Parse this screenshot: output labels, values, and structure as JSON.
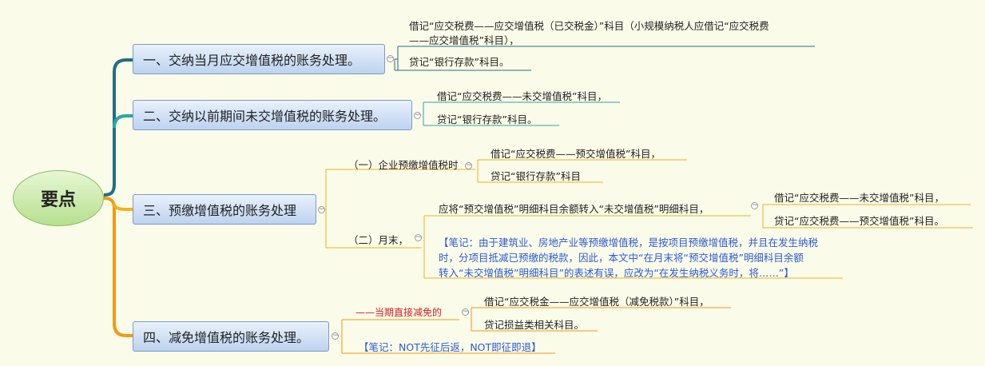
{
  "root": {
    "label": "要点"
  },
  "branches": [
    {
      "label": "一、交纳当月应交增值税的账务处理。",
      "leaves": [
        "借记“应交税费——应交增值税（已交税金）”科目（小规模纳税人应借记“应交税费",
        "——应交增值税”科目），",
        "贷记“银行存款”科目。"
      ]
    },
    {
      "label": "二、交纳以前期间未交增值税的账务处理。",
      "leaves": [
        "借记“应交税费——未交增值税”科目，",
        "贷记“银行存款”科目。"
      ]
    },
    {
      "label": "三、预缴增值税的账务处理",
      "sub1": {
        "label": "（一）企业预缴增值税时",
        "leaves": [
          "借记“应交税费——预交增值税”科目，",
          "贷记“银行存款”科目"
        ]
      },
      "sub2": {
        "label": "（二）月末，",
        "transfer": "应将“预交增值税”明细科目余额转入“未交增值税”明细科目，",
        "leaves": [
          "借记“应交税费——未交增值税”科目，",
          "贷记“应交税费——预交增值税”科目。"
        ],
        "note": [
          "【笔记：由于建筑业、房地产业等预缴增值税，是按项目预缴增值税，并且在发生纳税",
          "时，分项目抵减已预缴的税款，因此，本文中“在月末将“预交增值税”明细科目余额",
          "转入“未交增值税”明细科目”的表述有误，应改为“在发生纳税义务时，将……”】"
        ]
      }
    },
    {
      "label": "四、减免增值税的账务处理。",
      "sub": {
        "label": "——当期直接减免的",
        "leaves": [
          "借记“应交税金——应交增值税（减免税款）”科目，",
          "贷记损益类相关科目。"
        ]
      },
      "note": "【笔记：NOT先征后返，NOT即征即退】"
    }
  ],
  "colors": {
    "branch1": "#1f6f86",
    "branch2": "#2aa6a6",
    "branch3": "#f3b21a",
    "branch4": "#f19a14",
    "note": "#2a5bd7",
    "red": "#d21f1f",
    "root_fill": "#b6e08f",
    "main_fill": "#bcd3ef"
  }
}
